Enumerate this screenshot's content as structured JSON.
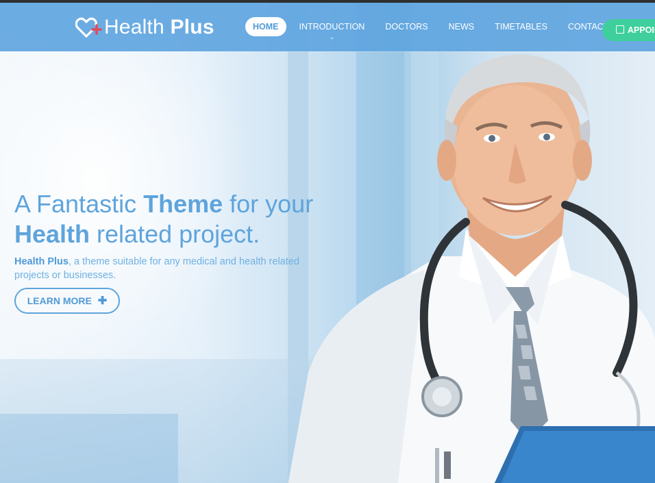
{
  "brand": {
    "name_light": "Health",
    "name_bold": "Plus",
    "icon": "heart-plus-icon",
    "accent_color": "#5fa5df",
    "plus_color": "#e2495b"
  },
  "nav": {
    "items": [
      {
        "label": "HOME",
        "active": true
      },
      {
        "label": "INTRODUCTION",
        "has_dropdown": true
      },
      {
        "label": "DOCTORS"
      },
      {
        "label": "NEWS"
      },
      {
        "label": "TIMETABLES"
      },
      {
        "label": "CONTACTS"
      }
    ],
    "dropdown_caret": "⌄",
    "appointment": {
      "label": "APPOIN",
      "icon": "calendar-icon",
      "color": "#3ecf9c"
    }
  },
  "hero": {
    "headline": {
      "part1": "A Fantastic ",
      "bold1": "Theme",
      "part2": " for your",
      "bold2": "Health",
      "part3": " related project."
    },
    "subtext": {
      "bold": "Health Plus",
      "rest": ", a theme suitable for any medical and health related projects or businesses."
    },
    "cta": {
      "label": "LEARN MORE",
      "icon": "plus-icon",
      "glyph": "✚"
    }
  }
}
